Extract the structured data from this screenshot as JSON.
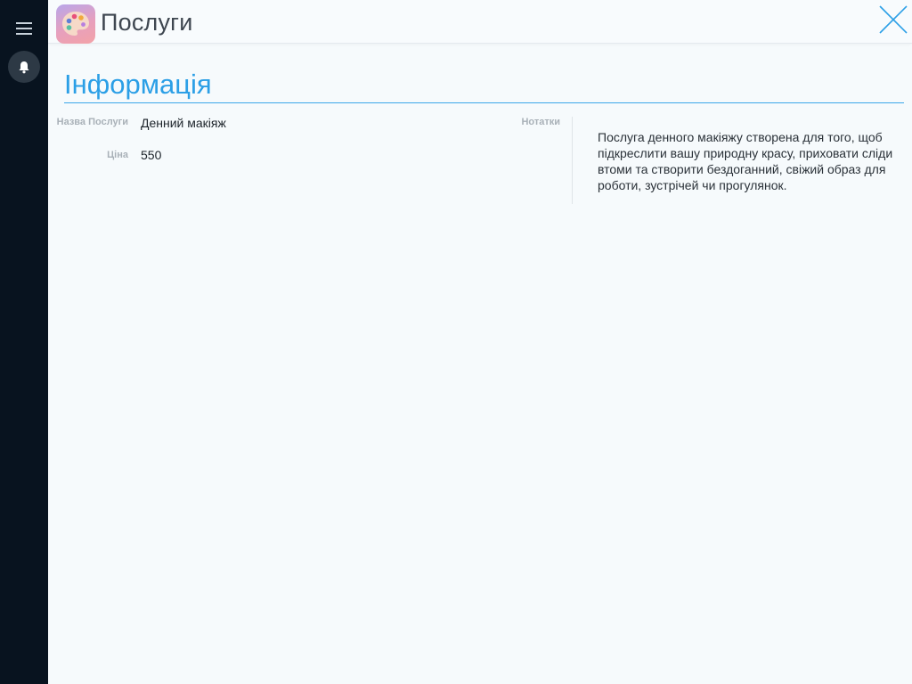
{
  "app": {
    "title": "Послуги",
    "icon": "palette-icon"
  },
  "sidebar": {
    "menu_icon": "hamburger-menu-icon",
    "notifications_icon": "bell-icon"
  },
  "header": {
    "close_icon": "close-icon"
  },
  "section": {
    "title": "Інформація"
  },
  "fields": {
    "name": {
      "label": "Назва Послуги",
      "value": "Денний макіяж"
    },
    "price": {
      "label": "Ціна",
      "value": "550"
    },
    "notes": {
      "label": "Нотатки",
      "value": "Послуга денного макіяжу створена для того, щоб підкреслити вашу природну красу, приховати сліди втоми та створити бездоганний, свіжий образ для роботи, зустрічей чи прогулянок."
    }
  },
  "colors": {
    "sidebar": "#08131f",
    "accent": "#2b9fe6",
    "background": "#f6fafc"
  }
}
